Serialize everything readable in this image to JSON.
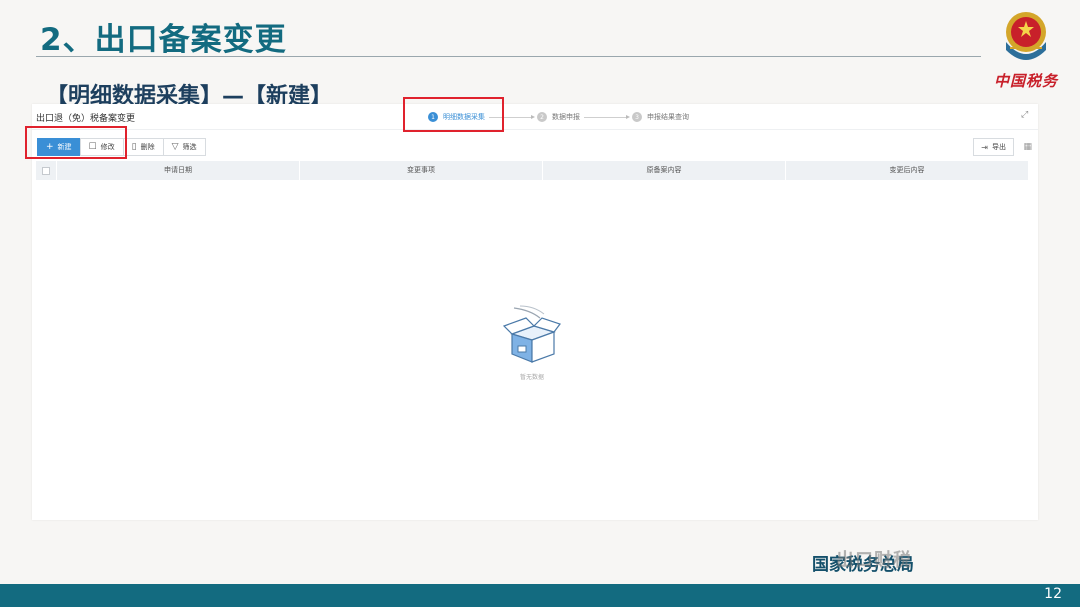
{
  "slide": {
    "title": "2、出口备案变更",
    "section": "【明细数据采集】—【新建】",
    "emblem_text": "中国税务",
    "watermark": "国家税务总局",
    "watermark_overlay": "出口财税",
    "page_number": "12",
    "colors": {
      "title": "#136b80",
      "bar": "#136b80",
      "highlight": "#e0222d",
      "primary": "#3a8fd6"
    }
  },
  "app": {
    "title": "出口退（免）税备案变更",
    "steps": [
      {
        "num": "1",
        "label": "明细数据采集",
        "active": true
      },
      {
        "num": "2",
        "label": "数据申报",
        "active": false
      },
      {
        "num": "3",
        "label": "申报结果查询",
        "active": false
      }
    ],
    "toolbar": {
      "new_label": "新建",
      "edit_label": "修改",
      "delete_label": "删除",
      "filter_label": "筛选",
      "export_label": "导出"
    },
    "table": {
      "columns": [
        "申请日期",
        "变更事项",
        "原备案内容",
        "变更后内容"
      ],
      "rows": []
    },
    "empty_text": "暂无数据"
  }
}
